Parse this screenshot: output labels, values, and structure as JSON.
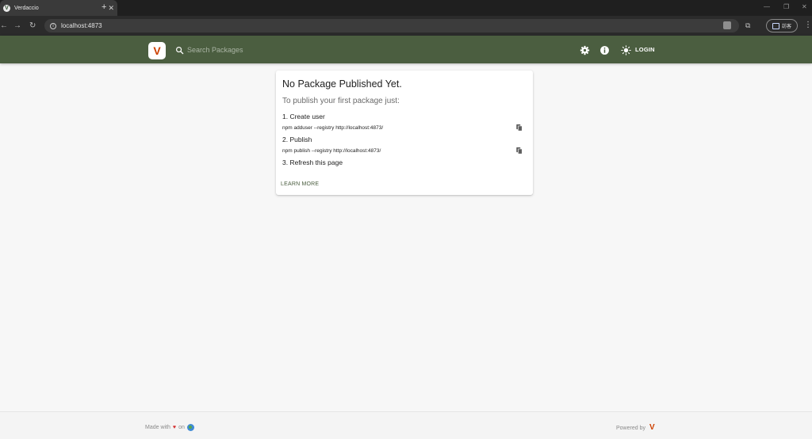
{
  "browser": {
    "tab_title": "Verdaccio",
    "tab_favicon_letter": "V",
    "url": "localhost:4873",
    "profile_label": "訪客"
  },
  "header": {
    "search_placeholder": "Search Packages",
    "login_label": "LOGIN",
    "icons": [
      "settings-icon",
      "info-icon",
      "theme-toggle-icon"
    ]
  },
  "card": {
    "title": "No Package Published Yet.",
    "subtitle": "To publish your first package just:",
    "step1": "1. Create user",
    "cmd1": "npm adduser --registry http://localhost:4873/",
    "step2": "2. Publish",
    "cmd2": "npm publish --registry http://localhost:4873/",
    "step3": "3. Refresh this page",
    "learn_more": "LEARN MORE"
  },
  "footer": {
    "made_with": "Made with",
    "on": "on",
    "powered_by": "Powered by"
  },
  "colors": {
    "header_bg": "#4b5e40",
    "brand_orange": "#cd4000",
    "page_bg": "#f7f7f7",
    "heart": "#d32f2f"
  }
}
